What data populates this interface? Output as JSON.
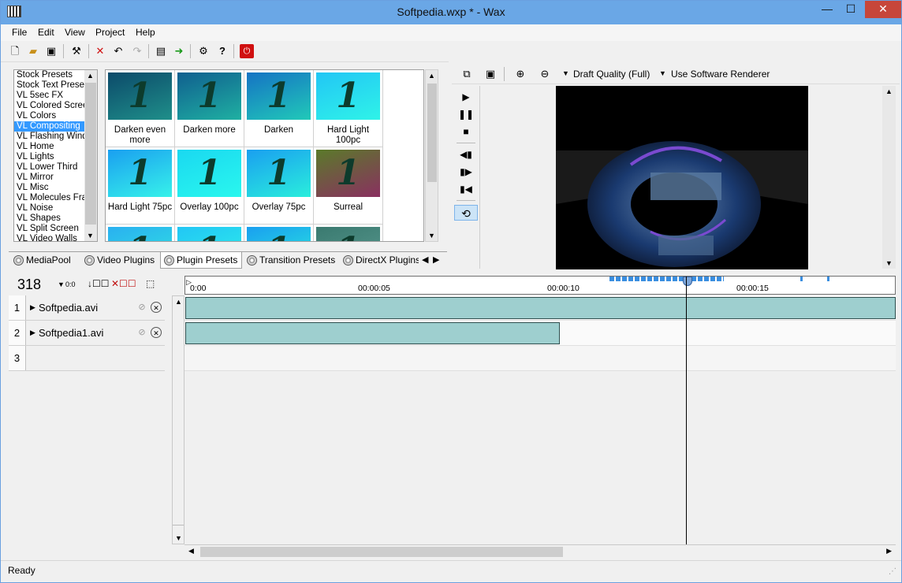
{
  "window": {
    "title": "Softpedia.wxp * - Wax",
    "minimize": "—",
    "maximize": "☐",
    "close": "✕"
  },
  "menu": [
    "File",
    "Edit",
    "View",
    "Project",
    "Help"
  ],
  "preset_categories": {
    "items": [
      "Stock Presets",
      "Stock Text Presets",
      "VL 5sec FX",
      "VL Colored Screens",
      "VL Colors",
      "VL Compositing",
      "VL Flashing Windows",
      "VL Home",
      "VL Lights",
      "VL Lower Third",
      "VL Mirror",
      "VL Misc",
      "VL Molecules Frames",
      "VL Noise",
      "VL Shapes",
      "VL Split Screen",
      "VL Video Walls"
    ],
    "selected": "VL Compositing"
  },
  "presets": [
    {
      "label": "Darken even more",
      "color_top": "#0c4a6a",
      "color_bottom": "#1f8f8a"
    },
    {
      "label": "Darken more",
      "color_top": "#105f8f",
      "color_bottom": "#1fb0a2"
    },
    {
      "label": "Darken",
      "color_top": "#1573c4",
      "color_bottom": "#21c9b8"
    },
    {
      "label": "Hard Light 100pc",
      "color_top": "#22c6f5",
      "color_bottom": "#2ff3e8"
    },
    {
      "label": "Hard Light 75pc",
      "color_top": "#1a9ff0",
      "color_bottom": "#37f2ea"
    },
    {
      "label": "Overlay 100pc",
      "color_top": "#1ad8f0",
      "color_bottom": "#2af7ee"
    },
    {
      "label": "Overlay 75pc",
      "color_top": "#1a9ff0",
      "color_bottom": "#2aeedc"
    },
    {
      "label": "Surreal",
      "color_top": "#5a7a2a",
      "color_bottom": "#8a3060"
    },
    {
      "label": "",
      "color_top": "#2ab0f0",
      "color_bottom": "#30e8e0"
    },
    {
      "label": "",
      "color_top": "#22c6f5",
      "color_bottom": "#2ff3e8"
    },
    {
      "label": "",
      "color_top": "#1a9ff0",
      "color_bottom": "#2aeedc"
    },
    {
      "label": "",
      "color_top": "#3a7a70",
      "color_bottom": "#5a9a90"
    }
  ],
  "tabs": [
    "MediaPool",
    "Video Plugins",
    "Plugin Presets",
    "Transition Presets",
    "DirectX Plugins"
  ],
  "active_tab": "Plugin Presets",
  "preview_toolbar": {
    "quality": "Draft Quality (Full)",
    "renderer": "Use Software Renderer"
  },
  "timeline": {
    "frame": "318",
    "zoom_label": "0:0",
    "ruler_labels": [
      "0:00",
      "00:00:05",
      "00:00:10",
      "00:00:15"
    ],
    "tracks": [
      {
        "num": "1",
        "name": "Softpedia.avi"
      },
      {
        "num": "2",
        "name": "Softpedia1.avi"
      },
      {
        "num": "3",
        "name": ""
      }
    ]
  },
  "status": "Ready",
  "colors": {
    "accent": "#3399ff",
    "titlebar": "#6aa7e6",
    "clip": "#9ecfcf",
    "close": "#c7463a"
  }
}
